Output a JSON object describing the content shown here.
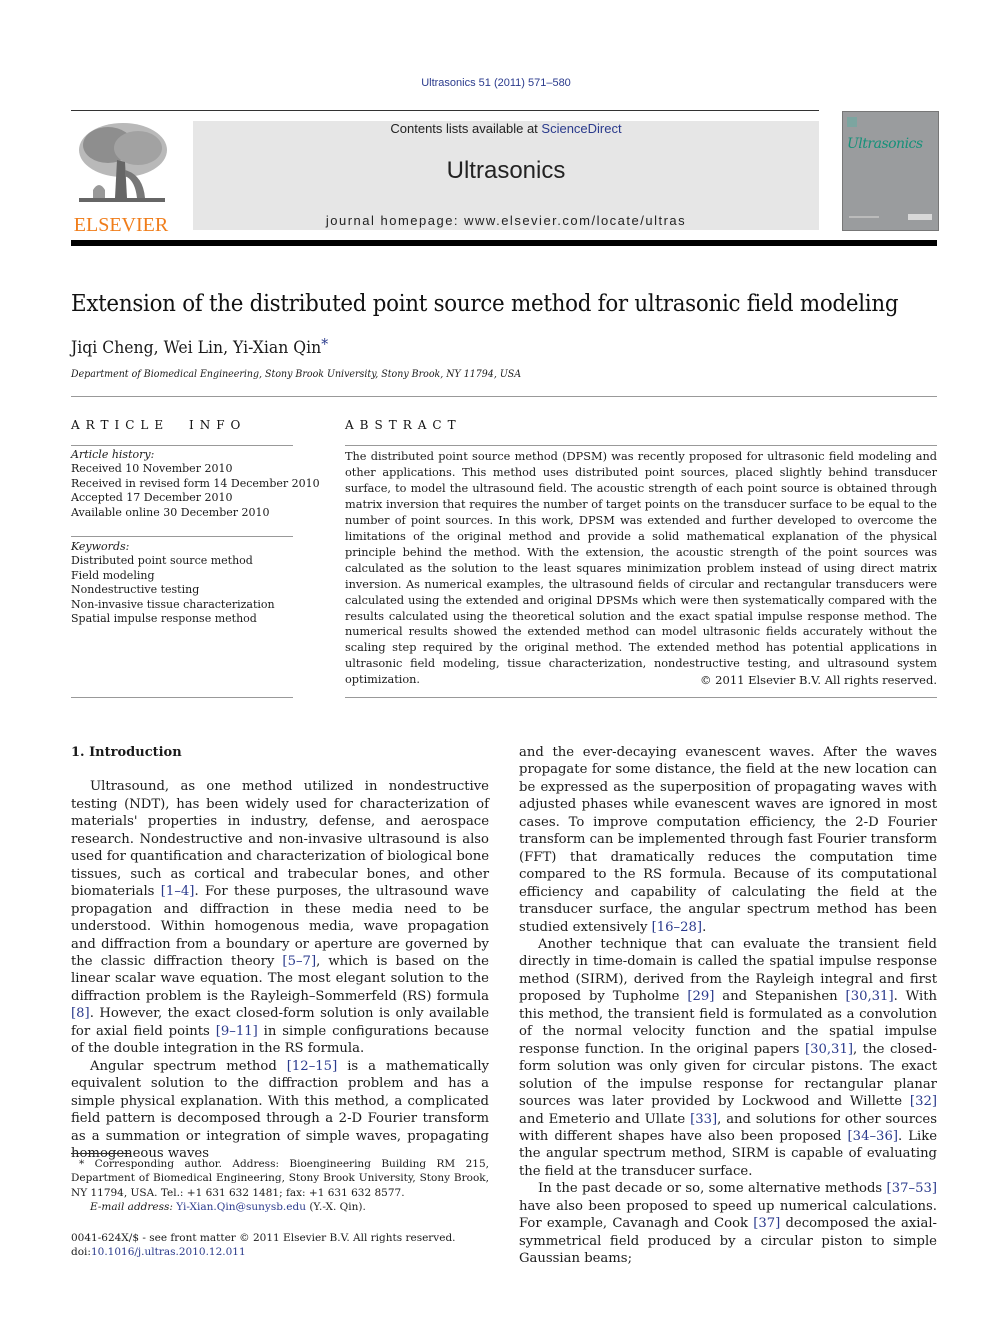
{
  "header": {
    "citation": "Ultrasonics 51 (2011) 571–580",
    "contents_prefix": "Contents lists available at ",
    "contents_link": "ScienceDirect",
    "journal_title": "Ultrasonics",
    "homepage_label": "journal homepage: www.elsevier.com/locate/ultras",
    "publisher_logo_text": "ELSEVIER",
    "cover_title": "Ultrasonics"
  },
  "colors": {
    "link": "#2a3a8c",
    "elsevier_orange": "#f07d1a",
    "masthead_bg": "#e6e6e6",
    "cover_teal": "#15917a"
  },
  "article": {
    "title": "Extension of the distributed point source method for ultrasonic field modeling",
    "authors": "Jiqi Cheng, Wei Lin, Yi-Xian Qin",
    "author_mark": "*",
    "affiliation": "Department of Biomedical Engineering, Stony Brook University, Stony Brook, NY 11794, USA"
  },
  "article_info": {
    "heading": "ARTICLE INFO",
    "history_label": "Article history:",
    "history": [
      "Received 10 November 2010",
      "Received in revised form 14 December 2010",
      "Accepted 17 December 2010",
      "Available online 30 December 2010"
    ],
    "keywords_label": "Keywords:",
    "keywords": [
      "Distributed point source method",
      "Field modeling",
      "Nondestructive testing",
      "Non-invasive tissue characterization",
      "Spatial impulse response method"
    ]
  },
  "abstract": {
    "heading": "ABSTRACT",
    "text": "The distributed point source method (DPSM) was recently proposed for ultrasonic field modeling and other applications. This method uses distributed point sources, placed slightly behind transducer surface, to model the ultrasound field. The acoustic strength of each point source is obtained through matrix inversion that requires the number of target points on the transducer surface to be equal to the number of point sources. In this work, DPSM was extended and further developed to overcome the limitations of the original method and provide a solid mathematical explanation of the physical principle behind the method. With the extension, the acoustic strength of the point sources was calculated as the solution to the least squares minimization problem instead of using direct matrix inversion. As numerical examples, the ultrasound fields of circular and rectangular transducers were calculated using the extended and original DPSMs which were then systematically compared with the results calculated using the theoretical solution and the exact spatial impulse response method. The numerical results showed the extended method can model ultrasonic fields accurately without the scaling step required by the original method. The extended method has potential applications in ultrasonic field modeling, tissue characterization, nondestructive testing, and ultrasound system optimization.",
    "copyright": "© 2011 Elsevier B.V. All rights reserved."
  },
  "body": {
    "section_heading": "1. Introduction",
    "left_col": [
      {
        "parts": [
          {
            "t": "Ultrasound, as one method utilized in nondestructive testing (NDT), has been widely used for characterization of materials' properties in industry, defense, and aerospace research. Nondestructive and non-invasive ultrasound is also used for quantification and characterization of biological bone tissues, such as cortical and trabecular bones, and other biomaterials "
          },
          {
            "ref": "[1–4]"
          },
          {
            "t": ". For these purposes, the ultrasound wave propagation and diffraction in these media need to be understood. Within homogenous media, wave propagation and diffraction from a boundary or aperture are governed by the classic diffraction theory "
          },
          {
            "ref": "[5–7]"
          },
          {
            "t": ", which is based on the linear scalar wave equation. The most elegant solution to the diffraction problem is the Rayleigh–Sommerfeld (RS) formula "
          },
          {
            "ref": "[8]"
          },
          {
            "t": ". However, the exact closed-form solution is only available for axial field points "
          },
          {
            "ref": "[9–11]"
          },
          {
            "t": " in simple configurations because of the double integration in the RS formula."
          }
        ]
      },
      {
        "parts": [
          {
            "t": "Angular spectrum method "
          },
          {
            "ref": "[12–15]"
          },
          {
            "t": " is a mathematically equivalent solution to the diffraction problem and has a simple physical explanation. With this method, a complicated field pattern is decomposed through a 2-D Fourier transform as a summation or integration of simple waves, propagating homogeneous waves"
          }
        ]
      }
    ],
    "right_col": [
      {
        "noindent": true,
        "parts": [
          {
            "t": "and the ever-decaying evanescent waves. After the waves propagate for some distance, the field at the new location can be expressed as the superposition of propagating waves with adjusted phases while evanescent waves are ignored in most cases. To improve computation efficiency, the 2-D Fourier transform can be implemented through fast Fourier transform (FFT) that dramatically reduces the computation time compared to the RS formula. Because of its computational efficiency and capability of calculating the field at the transducer surface, the angular spectrum method has been studied extensively "
          },
          {
            "ref": "[16–28]"
          },
          {
            "t": "."
          }
        ]
      },
      {
        "parts": [
          {
            "t": "Another technique that can evaluate the transient field directly in time-domain is called the spatial impulse response method (SIRM), derived from the Rayleigh integral and first proposed by Tupholme "
          },
          {
            "ref": "[29]"
          },
          {
            "t": " and Stepanishen "
          },
          {
            "ref": "[30,31]"
          },
          {
            "t": ". With this method, the transient field is formulated as a convolution of the normal velocity function and the spatial impulse response function. In the original papers "
          },
          {
            "ref": "[30,31]"
          },
          {
            "t": ", the closed-form solution was only given for circular pistons. The exact solution of the impulse response for rectangular planar sources was later provided by Lockwood and Willette "
          },
          {
            "ref": "[32]"
          },
          {
            "t": " and Emeterio and Ullate "
          },
          {
            "ref": "[33]"
          },
          {
            "t": ", and solutions for other sources with different shapes have also been proposed "
          },
          {
            "ref": "[34–36]"
          },
          {
            "t": ". Like the angular spectrum method, SIRM is capable of evaluating the field at the transducer surface."
          }
        ]
      },
      {
        "parts": [
          {
            "t": "In the past decade or so, some alternative methods "
          },
          {
            "ref": "[37–53]"
          },
          {
            "t": " have also been proposed to speed up numerical calculations. For example, Cavanagh and Cook "
          },
          {
            "ref": "[37]"
          },
          {
            "t": " decomposed the axial-symmetrical field produced by a circular piston to simple Gaussian beams;"
          }
        ]
      }
    ]
  },
  "footnote": {
    "corresponding": "* Corresponding author. Address: Bioengineering Building RM 215, Department of Biomedical Engineering, Stony Brook University, Stony Brook, NY 11794, USA. Tel.: +1 631 632 1481; fax: +1 631 632 8577.",
    "email_label": "E-mail address: ",
    "email": "Yi-Xian.Qin@sunysb.edu",
    "email_suffix": " (Y.-X. Qin).",
    "issn_line": "0041-624X/$ - see front matter © 2011 Elsevier B.V. All rights reserved.",
    "doi_prefix": "doi:",
    "doi": "10.1016/j.ultras.2010.12.011"
  }
}
